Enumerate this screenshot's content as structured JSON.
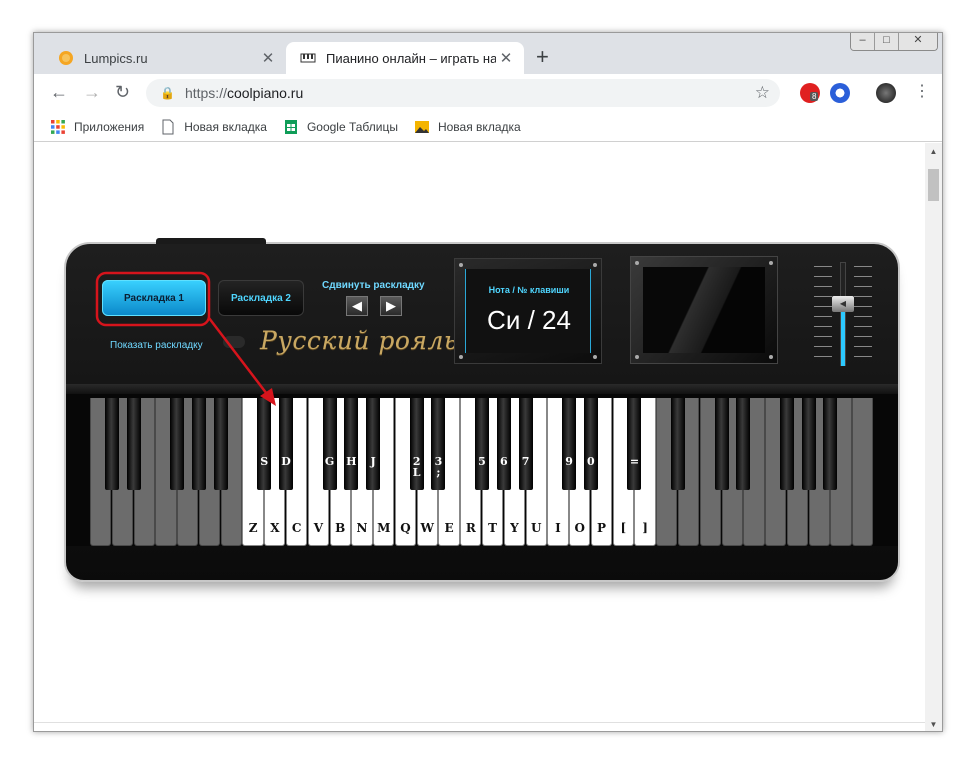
{
  "browser": {
    "tabs": [
      {
        "title": "Lumpics.ru",
        "active": false
      },
      {
        "title": "Пианино онлайн – играть на кл...",
        "active": true
      }
    ],
    "new_tab": "+",
    "close_glyph": "✕",
    "url_prefix": "https://",
    "url_host": "coolpiano.ru",
    "extension_badge": "8",
    "window_controls": {
      "minimize": "–",
      "maximize": "□",
      "close": "✕"
    }
  },
  "bookmarks": [
    {
      "label": "Приложения",
      "icon": "apps-grid-icon"
    },
    {
      "label": "Новая вкладка",
      "icon": "page-icon"
    },
    {
      "label": "Google Таблицы",
      "icon": "sheets-icon"
    },
    {
      "label": "Новая вкладка",
      "icon": "image-icon"
    }
  ],
  "piano": {
    "layout1_label": "Раскладка 1",
    "layout2_label": "Раскладка 2",
    "show_layout_label": "Показать раскладку",
    "shift_layout_label": "Сдвинуть раскладку",
    "shift_left": "◀",
    "shift_right": "▶",
    "brand": "Русский рояль",
    "display_caption": "Нота / № клавиши",
    "display_value": "Си / 24",
    "volume_level": 0.6,
    "white_keys": [
      {
        "label": "",
        "active": false
      },
      {
        "label": "",
        "active": false
      },
      {
        "label": "",
        "active": false
      },
      {
        "label": "",
        "active": false
      },
      {
        "label": "",
        "active": false
      },
      {
        "label": "",
        "active": false
      },
      {
        "label": "",
        "active": false
      },
      {
        "label": "Z",
        "active": true
      },
      {
        "label": "X",
        "active": true
      },
      {
        "label": "C",
        "active": true
      },
      {
        "label": "V",
        "active": true
      },
      {
        "label": "B",
        "active": true
      },
      {
        "label": "N",
        "active": true
      },
      {
        "label": "M",
        "active": true
      },
      {
        "label": "Q",
        "active": true
      },
      {
        "label": "W",
        "active": true
      },
      {
        "label": "E",
        "active": true
      },
      {
        "label": "R",
        "active": true
      },
      {
        "label": "T",
        "active": true
      },
      {
        "label": "Y",
        "active": true
      },
      {
        "label": "U",
        "active": true
      },
      {
        "label": "I",
        "active": true
      },
      {
        "label": "O",
        "active": true
      },
      {
        "label": "P",
        "active": true
      },
      {
        "label": "[",
        "active": true
      },
      {
        "label": "]",
        "active": true
      },
      {
        "label": "",
        "active": false
      },
      {
        "label": "",
        "active": false
      },
      {
        "label": "",
        "active": false
      },
      {
        "label": "",
        "active": false
      },
      {
        "label": "",
        "active": false
      },
      {
        "label": "",
        "active": false
      },
      {
        "label": "",
        "active": false
      },
      {
        "label": "",
        "active": false
      },
      {
        "label": "",
        "active": false
      },
      {
        "label": "",
        "active": false
      }
    ],
    "black_keys": [
      {
        "after": 0,
        "label": ""
      },
      {
        "after": 1,
        "label": ""
      },
      {
        "after": 3,
        "label": ""
      },
      {
        "after": 4,
        "label": ""
      },
      {
        "after": 5,
        "label": ""
      },
      {
        "after": 7,
        "label": "S"
      },
      {
        "after": 8,
        "label": "D"
      },
      {
        "after": 10,
        "label": "G"
      },
      {
        "after": 11,
        "label": "H"
      },
      {
        "after": 12,
        "label": "J"
      },
      {
        "after": 14,
        "label": "2\nL"
      },
      {
        "after": 15,
        "label": "3\n;"
      },
      {
        "after": 17,
        "label": "5"
      },
      {
        "after": 18,
        "label": "6"
      },
      {
        "after": 19,
        "label": "7"
      },
      {
        "after": 21,
        "label": "9"
      },
      {
        "after": 22,
        "label": "0"
      },
      {
        "after": 24,
        "label": "="
      },
      {
        "after": 26,
        "label": ""
      },
      {
        "after": 28,
        "label": ""
      },
      {
        "after": 29,
        "label": ""
      },
      {
        "after": 31,
        "label": ""
      },
      {
        "after": 32,
        "label": ""
      },
      {
        "after": 33,
        "label": ""
      }
    ]
  },
  "colors": {
    "accent": "#2cc9ff",
    "highlight": "#d6141c",
    "brand_gold": "#c9a862"
  }
}
